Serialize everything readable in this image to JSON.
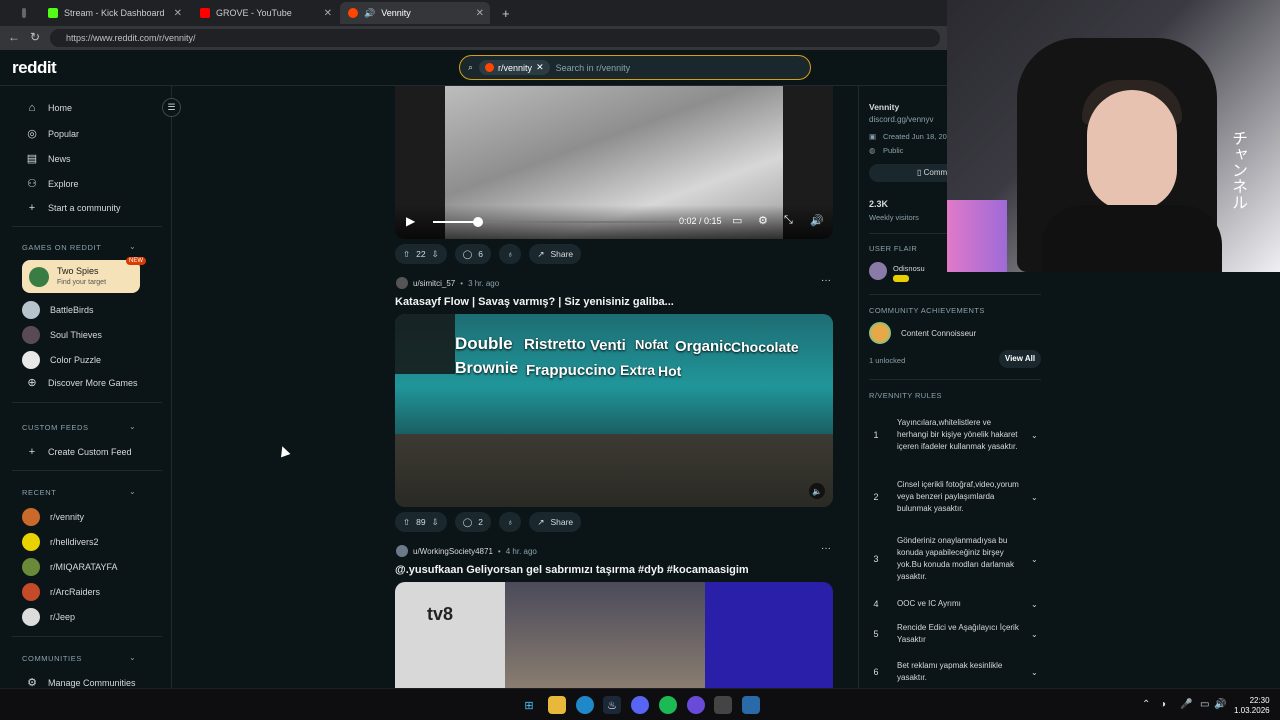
{
  "browser": {
    "tabs": [
      {
        "label": "Stream - Kick Dashboard",
        "color": "#53fc18"
      },
      {
        "label": "GROVE - YouTube",
        "color": "#ff0000"
      },
      {
        "label": "Vennity",
        "color": "#ff4500"
      }
    ],
    "url": "https://www.reddit.com/r/vennity/"
  },
  "header": {
    "logo": "reddit",
    "search_chip": "r/vennity",
    "search_placeholder": "Search in r/vennity"
  },
  "sidebar": {
    "nav": [
      {
        "label": "Home",
        "icon": "home-icon"
      },
      {
        "label": "Popular",
        "icon": "popular-icon"
      },
      {
        "label": "News",
        "icon": "news-icon"
      },
      {
        "label": "Explore",
        "icon": "explore-icon"
      },
      {
        "label": "Start a community",
        "icon": "plus-icon"
      }
    ],
    "games_header": "GAMES ON REDDIT",
    "featured_game": {
      "title": "Two Spies",
      "subtitle": "Find your target",
      "badge": "NEW"
    },
    "games": [
      "BattleBirds",
      "Soul Thieves",
      "Color Puzzle",
      "Discover More Games"
    ],
    "custom_feeds_header": "CUSTOM FEEDS",
    "create_feed": "Create Custom Feed",
    "recent_header": "RECENT",
    "recent": [
      "r/vennity",
      "r/helldivers2",
      "r/MIQARATAYFA",
      "r/ArcRaiders",
      "r/Jeep"
    ],
    "communities_header": "COMMUNITIES",
    "manage": "Manage Communities"
  },
  "video_player": {
    "time": "0:02 / 0:15",
    "progress": 0.18
  },
  "posts": [
    {
      "votes": "22",
      "comments": "6",
      "share": "Share"
    },
    {
      "author": "u/simitci_57",
      "ago": "3 hr. ago",
      "title": "Katasayf Flow | Savaş varmış? | Siz yenisiniz galiba...",
      "captions": [
        "Double",
        "Ristretto",
        "Venti",
        "Nofat",
        "Organic",
        "Chocolate",
        "Brownie",
        "Frappuccino",
        "Extra",
        "Hot"
      ],
      "votes": "89",
      "comments": "2",
      "share": "Share"
    },
    {
      "author": "u/WorkingSociety4871",
      "ago": "4 hr. ago",
      "title": "@.yusufkaan Geliyorsan gel sabrımızı taşırma #dyb #kocamaasigim"
    }
  ],
  "community": {
    "name": "Vennity",
    "link": "discord.gg/vennyv",
    "created": "Created Jun 18, 202",
    "visibility": "Public",
    "button": "Comm",
    "visitors": "2.3K",
    "visitors_label": "Weekly visitors",
    "user_flair_header": "USER FLAIR",
    "flair_user": "Odisnosu",
    "achievements_header": "COMMUNITY ACHIEVEMENTS",
    "achievement": "Content Connoisseur",
    "unlocked": "1 unlocked",
    "view_all": "View All",
    "rules_header": "R/VENNITY RULES",
    "rules": [
      {
        "num": "1",
        "text": "Yayıncılara,whitelistlere ve herhangi bir kişiye yönelik hakaret içeren ifadeler kullanmak yasaktır."
      },
      {
        "num": "2",
        "text": "Cinsel içerikli fotoğraf,video,yorum veya benzeri paylaşımlarda bulunmak yasaktır."
      },
      {
        "num": "3",
        "text": "Gönderiniz onaylanmadıysa bu konuda yapabileceğiniz birşey yok.Bu konuda modları darlamak yasaktır."
      },
      {
        "num": "4",
        "text": "OOC ve IC Ayrımı"
      },
      {
        "num": "5",
        "text": "Rencide Edici ve Aşağılayıcı İçerik Yasaktır"
      },
      {
        "num": "6",
        "text": "Bet reklamı yapmak kesinlikle yasaktır."
      }
    ]
  },
  "webcam": {
    "overlay_text": "チャンネル"
  },
  "taskbar": {
    "time": "22:30",
    "date": "1.03.2026"
  },
  "colors": {
    "accent": "#d5a014",
    "brand": "#ff4500",
    "bg": "#0b1416"
  }
}
